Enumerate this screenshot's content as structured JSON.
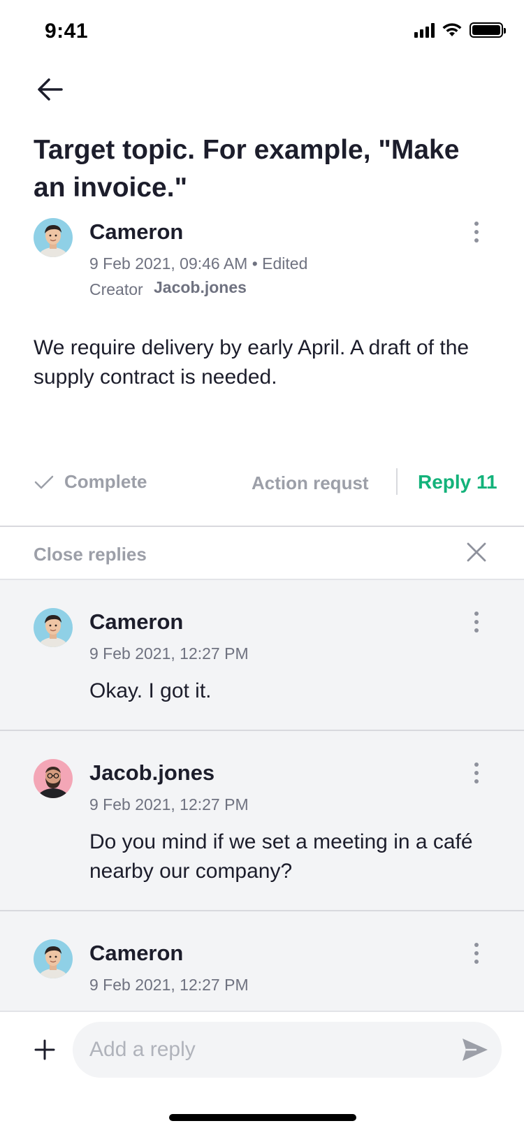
{
  "status_bar": {
    "time": "9:41"
  },
  "post": {
    "title": "Target topic. For example, \"Make an invoice.\"",
    "author": "Cameron",
    "meta": "9 Feb 2021, 09:46 AM • Edited",
    "creator_label": "Creator",
    "creator_name": "Jacob.jones",
    "body": "We require delivery by early April. A draft of the supply contract is needed."
  },
  "actions": {
    "complete_label": "Complete",
    "action_request_label": "Action requst",
    "reply_label": "Reply 11",
    "accent_color": "#13b27a"
  },
  "replies_panel": {
    "close_label": "Close replies"
  },
  "replies": [
    {
      "author": "Cameron",
      "time": "9 Feb 2021, 12:27 PM",
      "text": "Okay. I got it.",
      "avatar_icon": "cameron-avatar"
    },
    {
      "author": "Jacob.jones",
      "time": "9 Feb 2021, 12:27 PM",
      "text": "Do you mind if we set a meeting in a café nearby our company?",
      "avatar_icon": "jacob-avatar"
    },
    {
      "author": "Cameron",
      "time": "9 Feb 2021, 12:27 PM",
      "text": "",
      "avatar_icon": "cameron-avatar"
    }
  ],
  "composer": {
    "placeholder": "Add a reply",
    "value": ""
  }
}
